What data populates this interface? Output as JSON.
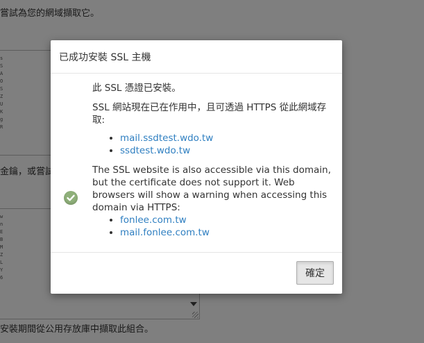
{
  "background": {
    "top_text": "嘗試為您的網域擷取它。",
    "mid_text": "金鑰，或嘗試",
    "bottom_text": "安裝期間從公用存放庫中擷取此組合。",
    "box1_chars": "sSAOSZUKgR",
    "box2_chars": "wnEBMZLY6"
  },
  "modal": {
    "title": "已成功安裝 SSL 主機",
    "status_icon": "check-circle-icon",
    "cert_installed": "此 SSL 憑證已安裝。",
    "active_text": "SSL 網站現在已在作用中，且可透過 HTTPS 從此網域存取:",
    "active_domains": [
      "mail.ssdtest.wdo.tw",
      "ssdtest.wdo.tw"
    ],
    "warning_text": "The SSL website is also accessible via this domain, but the certificate does not support it. Web browsers will show a warning when accessing this domain via HTTPS:",
    "warning_domains": [
      "fonlee.com.tw",
      "mail.fonlee.com.tw"
    ],
    "ok_label": "確定"
  },
  "colors": {
    "link": "#2f7fc1",
    "success_icon": "#8fb07a",
    "overlay": "rgba(0,0,0,0.5)"
  }
}
